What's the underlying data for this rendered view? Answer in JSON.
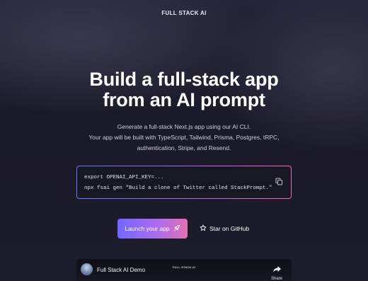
{
  "header": {
    "brand": "FULL STACK AI"
  },
  "hero": {
    "headline_line1": "Build a full-stack app",
    "headline_line2": "from an AI prompt",
    "sub_line1": "Generate a full-stack Next.js app using our AI CLI.",
    "sub_line2": "Your app will be built with TypeScript, Tailwind, Prisma, Postgres, tRPC,",
    "sub_line3": "authentication, Stripe, and Resend."
  },
  "code": {
    "line1": "export OPENAI_API_KEY=...",
    "line2": "npx fsai gen \"Build a clone of Twitter called StackPrompt.\"",
    "copy_icon": "copy-icon"
  },
  "actions": {
    "launch_label": "Launch your app",
    "launch_icon": "rocket-icon",
    "github_label": "Star on GitHub",
    "github_icon": "star-icon"
  },
  "video": {
    "title": "Full Stack AI Demo",
    "embedded_brand": "FULL STACK AI",
    "share_label": "Share",
    "share_icon": "share-arrow-icon"
  },
  "colors": {
    "background": "#1c1b2b",
    "accent_start": "#7268ff",
    "accent_end": "#e46fb2"
  }
}
